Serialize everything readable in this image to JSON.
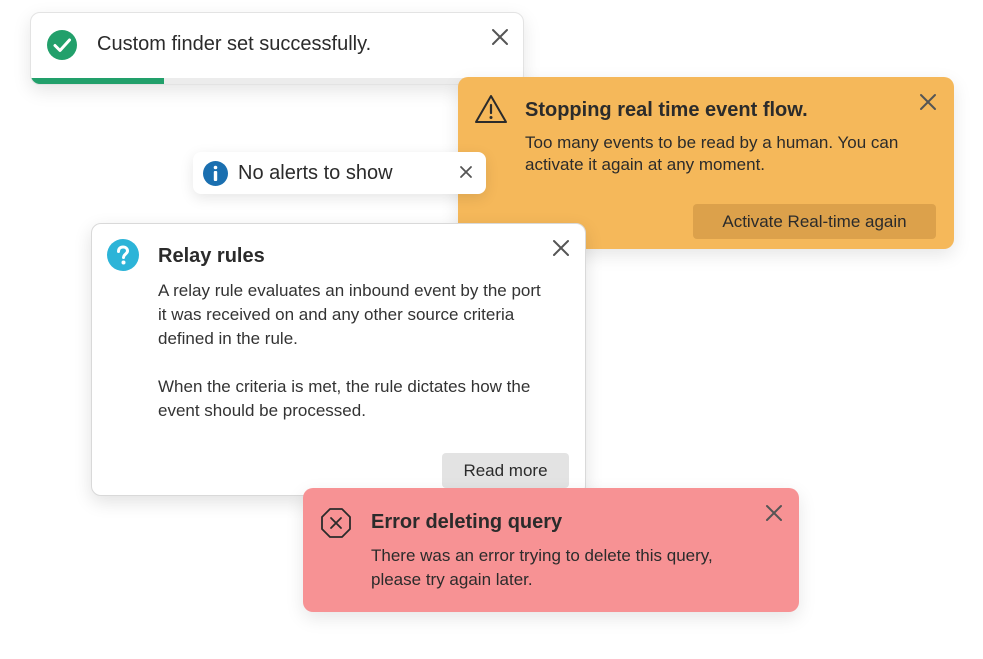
{
  "toasts": {
    "success": {
      "message": "Custom finder set successfully.",
      "progress": 0.27,
      "icon": "check-circle-icon",
      "accent_color": "#22a06b"
    },
    "warning": {
      "title": "Stopping real time event flow.",
      "body": "Too many events to be read by a human. You can activate it again at any moment.",
      "action_label": "Activate Real-time again",
      "icon": "warning-triangle-icon",
      "background_color": "#f5b85a"
    },
    "info": {
      "message": "No alerts to show",
      "icon": "info-circle-icon",
      "accent_color": "#1a6fb0"
    },
    "help": {
      "title": "Relay rules",
      "paragraph1": "A relay rule evaluates an inbound event by the port it was received on and any other source criteria defined in the rule.",
      "paragraph2": "When the criteria is met, the rule dictates how the event should be processed.",
      "action_label": "Read more",
      "icon": "question-circle-icon",
      "accent_color": "#2cb4d8"
    },
    "error": {
      "title": "Error deleting query",
      "body": "There was an error trying to delete this query, please try again later.",
      "icon": "error-octagon-icon",
      "background_color": "#f79294"
    }
  }
}
